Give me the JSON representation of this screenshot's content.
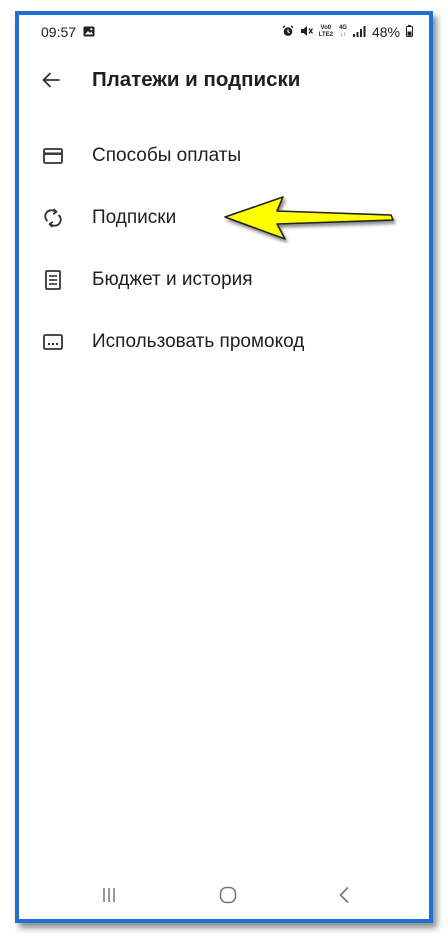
{
  "status_bar": {
    "time": "09:57",
    "volte_top": "Vo0",
    "volte_bottom": "LTE2",
    "net_top": "4G",
    "net_bottom": "↓↑",
    "battery": "48%"
  },
  "header": {
    "title": "Платежи и подписки"
  },
  "menu": {
    "items": [
      {
        "label": "Способы оплаты",
        "icon": "credit-card-icon"
      },
      {
        "label": "Подписки",
        "icon": "sync-icon"
      },
      {
        "label": "Бюджет и история",
        "icon": "receipt-icon"
      },
      {
        "label": "Использовать промокод",
        "icon": "promo-code-icon"
      }
    ]
  },
  "colors": {
    "frame": "#1f6fd6",
    "arrow_fill": "#ffff00",
    "text": "#1f1f1f"
  }
}
